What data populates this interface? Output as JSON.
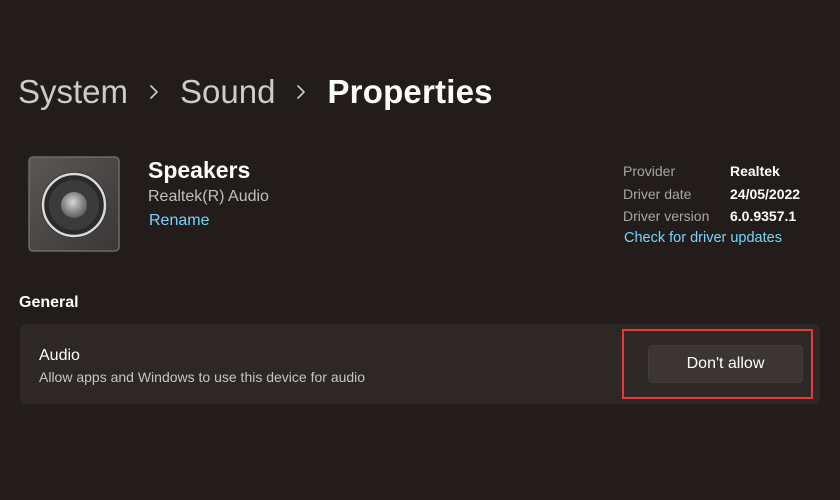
{
  "breadcrumb": {
    "items": [
      "System",
      "Sound",
      "Properties"
    ]
  },
  "device": {
    "name": "Speakers",
    "subtitle": "Realtek(R) Audio",
    "rename_label": "Rename",
    "icon": "speaker-icon"
  },
  "driver": {
    "rows": [
      {
        "label": "Provider",
        "value": "Realtek"
      },
      {
        "label": "Driver date",
        "value": "24/05/2022"
      },
      {
        "label": "Driver version",
        "value": "6.0.9357.1"
      }
    ],
    "update_link": "Check for driver updates"
  },
  "general": {
    "title": "General",
    "audio": {
      "title": "Audio",
      "description": "Allow apps and Windows to use this device for audio",
      "button_label": "Don't allow"
    }
  },
  "colors": {
    "background": "#221d1a",
    "card": "#2d2826",
    "link": "#78d3ff",
    "highlight": "#e53935"
  }
}
